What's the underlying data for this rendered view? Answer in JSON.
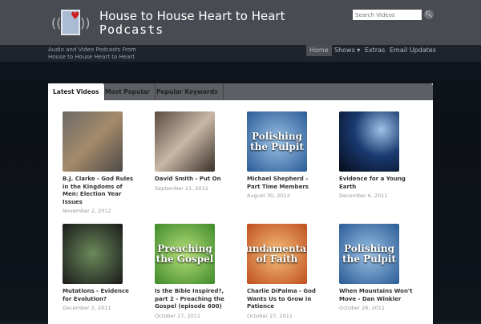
{
  "header": {
    "title_line1": "House to House Heart to Heart",
    "title_line2": "Podcasts",
    "search_placeholder": "Search Videos",
    "tagline": "Audio and Video Podcasts From House to House Heart to Heart"
  },
  "nav": [
    {
      "label": "Home"
    },
    {
      "label": "Shows ▾"
    },
    {
      "label": "Extras"
    },
    {
      "label": "Email Updates"
    }
  ],
  "tabs": [
    {
      "label": "Latest Videos"
    },
    {
      "label": "Most Popular"
    },
    {
      "label": "Popular Keywords"
    }
  ],
  "videos": [
    {
      "title": "B.J. Clarke - God Rules in the Kingdoms of Men: Election Year Issues",
      "date": "November 2, 2012",
      "thumb_text": ""
    },
    {
      "title": "David Smith - Put On",
      "date": "September 21, 2012",
      "thumb_text": ""
    },
    {
      "title": "Michael Shepherd - Part Time Members",
      "date": "August 30, 2012",
      "thumb_text": "Polishing the Pulpit"
    },
    {
      "title": "Evidence for a Young Earth",
      "date": "December 6, 2011",
      "thumb_text": ""
    },
    {
      "title": "Mutations - Evidence for Evolution?",
      "date": "December 2, 2011",
      "thumb_text": ""
    },
    {
      "title": "Is the Bible Inspired?, part 2 - Preaching the Gospel (episode 600)",
      "date": "October 27, 2011",
      "thumb_text": "Preaching the Gospel"
    },
    {
      "title": "Charlie DiPalma - God Wants Us to Grow in Patience",
      "date": "October 27, 2011",
      "thumb_text": "Fundamentals of Faith"
    },
    {
      "title": "When Mountains Won't Move - Dan Winkler",
      "date": "October 26, 2011",
      "thumb_text": "Polishing the Pulpit"
    }
  ]
}
